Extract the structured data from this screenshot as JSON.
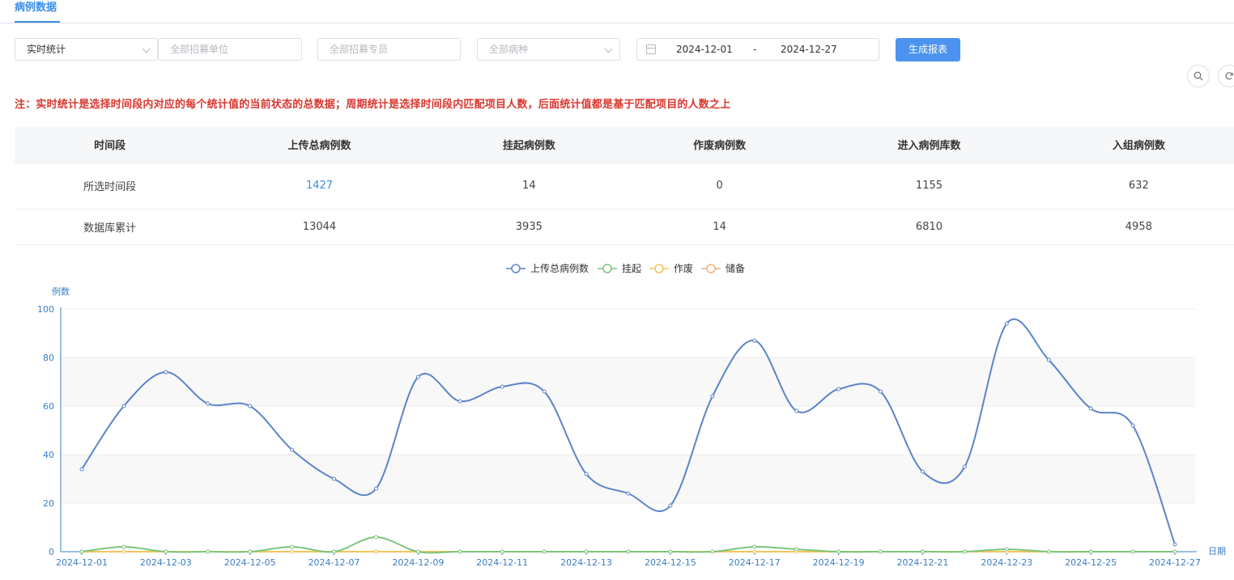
{
  "tab": {
    "active_label": "病例数据"
  },
  "filters": {
    "mode_value": "实时统计",
    "unit_placeholder": "全部招募单位",
    "specialist_placeholder": "全部招募专员",
    "disease_placeholder": "全部病种",
    "date_start": "2024-12-01",
    "date_separator": "-",
    "date_end": "2024-12-27",
    "generate_label": "生成报表"
  },
  "toolbar": {
    "search_icon": "search-icon",
    "refresh_icon": "refresh-icon"
  },
  "note": "注：实时统计是选择时间段内对应的每个统计值的当前状态的总数据；周期统计是选择时间段内匹配项目人数，后面统计值都是基于匹配项目的人数之上",
  "table": {
    "headers": [
      "时间段",
      "上传总病例数",
      "挂起病例数",
      "作废病例数",
      "进入病例库数",
      "入组病例数"
    ],
    "rows": [
      [
        "所选时间段",
        "1427",
        "14",
        "0",
        "1155",
        "632"
      ],
      [
        "数据库累计",
        "13044",
        "3935",
        "14",
        "6810",
        "4958"
      ]
    ]
  },
  "colors": {
    "accent": "#3a8ee6",
    "note": "#d9362e",
    "button": "#4c93f0"
  },
  "chart_data": {
    "type": "line",
    "ylabel": "例数",
    "xlabel": "日期",
    "ylim": [
      0,
      100
    ],
    "yticks": [
      0,
      20,
      40,
      60,
      80,
      100
    ],
    "x": [
      "2024-12-01",
      "2024-12-02",
      "2024-12-03",
      "2024-12-04",
      "2024-12-05",
      "2024-12-06",
      "2024-12-07",
      "2024-12-08",
      "2024-12-09",
      "2024-12-10",
      "2024-12-11",
      "2024-12-12",
      "2024-12-13",
      "2024-12-14",
      "2024-12-15",
      "2024-12-16",
      "2024-12-17",
      "2024-12-18",
      "2024-12-19",
      "2024-12-20",
      "2024-12-21",
      "2024-12-22",
      "2024-12-23",
      "2024-12-24",
      "2024-12-25",
      "2024-12-26",
      "2024-12-27"
    ],
    "xtick_labels": [
      "2024-12-01",
      "2024-12-03",
      "2024-12-05",
      "2024-12-07",
      "2024-12-09",
      "2024-12-11",
      "2024-12-13",
      "2024-12-15",
      "2024-12-17",
      "2024-12-19",
      "2024-12-21",
      "2024-12-23",
      "2024-12-25",
      "2024-12-27"
    ],
    "legend_position": "top-center",
    "series": [
      {
        "name": "上传总病例数",
        "color": "#5b84c8",
        "values": [
          34,
          60,
          74,
          61,
          60,
          42,
          30,
          26,
          72,
          62,
          68,
          66,
          32,
          24,
          19,
          64,
          87,
          58,
          67,
          66,
          33,
          35,
          94,
          79,
          59,
          52,
          3
        ]
      },
      {
        "name": "挂起",
        "color": "#7cc57c",
        "values": [
          0,
          2,
          0,
          0,
          0,
          2,
          0,
          6,
          0,
          0,
          0,
          0,
          0,
          0,
          0,
          0,
          2,
          1,
          0,
          0,
          0,
          0,
          1,
          0,
          0,
          0,
          0
        ]
      },
      {
        "name": "作废",
        "color": "#f2c55c",
        "values": [
          0,
          0,
          0,
          0,
          0,
          0,
          0,
          0,
          0,
          0,
          0,
          0,
          0,
          0,
          0,
          0,
          0,
          0,
          0,
          0,
          0,
          0,
          0,
          0,
          0,
          0,
          0
        ]
      },
      {
        "name": "储备",
        "color": "#f0b080",
        "values": [
          0,
          0,
          0,
          0,
          0,
          0,
          0,
          0,
          0,
          0,
          0,
          0,
          0,
          0,
          0,
          0,
          0,
          0,
          0,
          0,
          0,
          0,
          0,
          0,
          0,
          0,
          0
        ]
      }
    ]
  }
}
